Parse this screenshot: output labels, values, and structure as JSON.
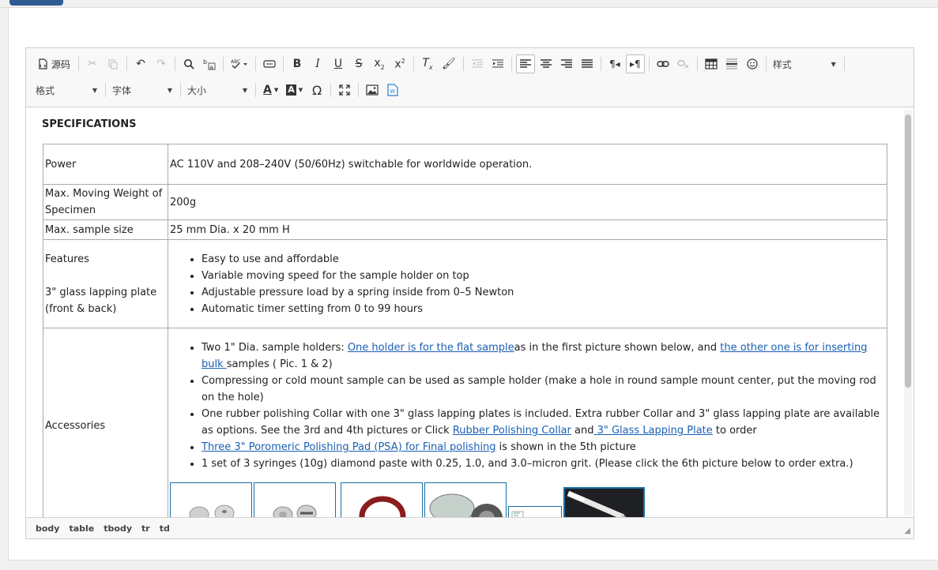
{
  "toolbar": {
    "source_label": "源码",
    "styles_combo": "样式",
    "format_combo": "格式",
    "font_combo": "字体",
    "size_combo": "大小",
    "text_color_letter": "A",
    "bg_color_letter": "A"
  },
  "document": {
    "heading": "SPECIFICATIONS",
    "rows": {
      "power": {
        "label": "Power",
        "value": "AC 110V and 208–240V (50/60Hz) switchable for worldwide operation."
      },
      "weight": {
        "label": "Max. Moving Weight of Specimen",
        "value": "200g"
      },
      "size": {
        "label": "Max. sample size",
        "value": "25 mm Dia. x 20 mm H"
      },
      "features": {
        "label1": "Features",
        "label2": "3\" glass lapping plate (front & back)",
        "items": [
          "Easy to use and affordable",
          "Variable moving speed for the sample holder on top",
          "Adjustable pressure load by a spring inside from 0–5 Newton",
          "Automatic timer setting from 0 to 99 hours"
        ]
      },
      "accessories": {
        "label": "Accessories",
        "item1_pre": "Two 1\" Dia. sample holders: ",
        "item1_link1": " One holder is for the flat sample",
        "item1_mid": "as in the first picture shown below, and ",
        "item1_link2": "the other one is for inserting bulk ",
        "item1_post": "samples ( Pic. 1 & 2)",
        "item2": "Compressing or cold mount sample can be used as sample holder (make a hole in round sample mount center, put the moving rod on the hole)",
        "item3_pre": "One rubber polishing Collar with one 3\" glass lapping plates is included. Extra rubber Collar and 3\" glass lapping plate are available as options. See the 3rd and 4th pictures or Click ",
        "item3_link1": "Rubber Polishing Collar",
        "item3_mid": " and",
        "item3_link2": " 3\" Glass Lapping Plate",
        "item3_post": " to order",
        "item4_link": "Three 3\" Poromeric Polishing Pad (PSA) for Final polishing",
        "item4_post": " is shown in the 5th picture",
        "item5": "1 set of 3 syringes (10g) diamond paste with 0.25, 1.0, and 3.0–micron grit. (Please click the 6th picture below to order extra.)"
      }
    }
  },
  "statusbar": {
    "path": [
      "body",
      "table",
      "tbody",
      "tr",
      "td"
    ]
  },
  "colors": {
    "link": "#1a5fb4",
    "tab_accent": "#2f5a94"
  }
}
